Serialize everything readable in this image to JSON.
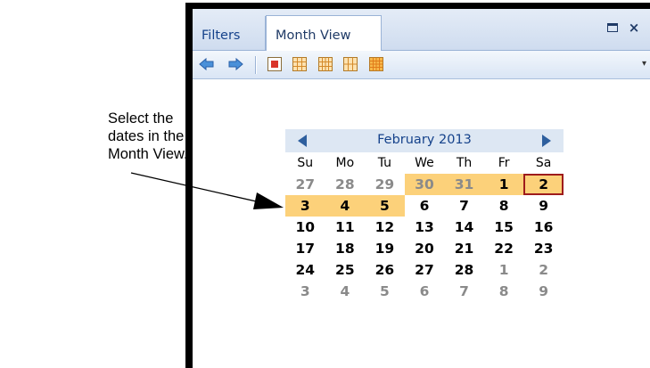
{
  "annotation": {
    "lines": [
      "Select the",
      "dates in the",
      "Month View."
    ]
  },
  "tabs": [
    {
      "label": "Filters",
      "active": false
    },
    {
      "label": "Month View",
      "active": true
    }
  ],
  "window_buttons": {
    "maximize": "maximize-icon",
    "close": "×"
  },
  "toolbar": {
    "buttons": [
      "back-arrow-icon",
      "forward-arrow-icon",
      "day-view-icon",
      "work-week-view-icon",
      "week-view-icon",
      "two-week-view-icon",
      "month-view-icon"
    ],
    "overflow": "▾"
  },
  "calendar": {
    "title": "February 2013",
    "weekdays": [
      "Su",
      "Mo",
      "Tu",
      "We",
      "Th",
      "Fr",
      "Sa"
    ],
    "weeks": [
      [
        {
          "d": "27",
          "m": true
        },
        {
          "d": "28",
          "m": true
        },
        {
          "d": "29",
          "m": true
        },
        {
          "d": "30",
          "m": true,
          "s": true
        },
        {
          "d": "31",
          "m": true,
          "s": true
        },
        {
          "d": "1",
          "s": true
        },
        {
          "d": "2",
          "s": true,
          "t": true
        }
      ],
      [
        {
          "d": "3",
          "s": true
        },
        {
          "d": "4",
          "s": true
        },
        {
          "d": "5",
          "s": true
        },
        {
          "d": "6"
        },
        {
          "d": "7"
        },
        {
          "d": "8"
        },
        {
          "d": "9"
        }
      ],
      [
        {
          "d": "10"
        },
        {
          "d": "11"
        },
        {
          "d": "12"
        },
        {
          "d": "13"
        },
        {
          "d": "14"
        },
        {
          "d": "15"
        },
        {
          "d": "16"
        }
      ],
      [
        {
          "d": "17"
        },
        {
          "d": "18"
        },
        {
          "d": "19"
        },
        {
          "d": "20"
        },
        {
          "d": "21"
        },
        {
          "d": "22"
        },
        {
          "d": "23"
        }
      ],
      [
        {
          "d": "24"
        },
        {
          "d": "25"
        },
        {
          "d": "26"
        },
        {
          "d": "27"
        },
        {
          "d": "28"
        },
        {
          "d": "1",
          "m": true
        },
        {
          "d": "2",
          "m": true
        }
      ],
      [
        {
          "d": "3",
          "m": true
        },
        {
          "d": "4",
          "m": true
        },
        {
          "d": "5",
          "m": true
        },
        {
          "d": "6",
          "m": true
        },
        {
          "d": "7",
          "m": true
        },
        {
          "d": "8",
          "m": true
        },
        {
          "d": "9",
          "m": true
        }
      ]
    ]
  },
  "colors": {
    "selection": "#fcd17a",
    "today_border": "#9e1b1b",
    "header_text": "#15428b"
  }
}
